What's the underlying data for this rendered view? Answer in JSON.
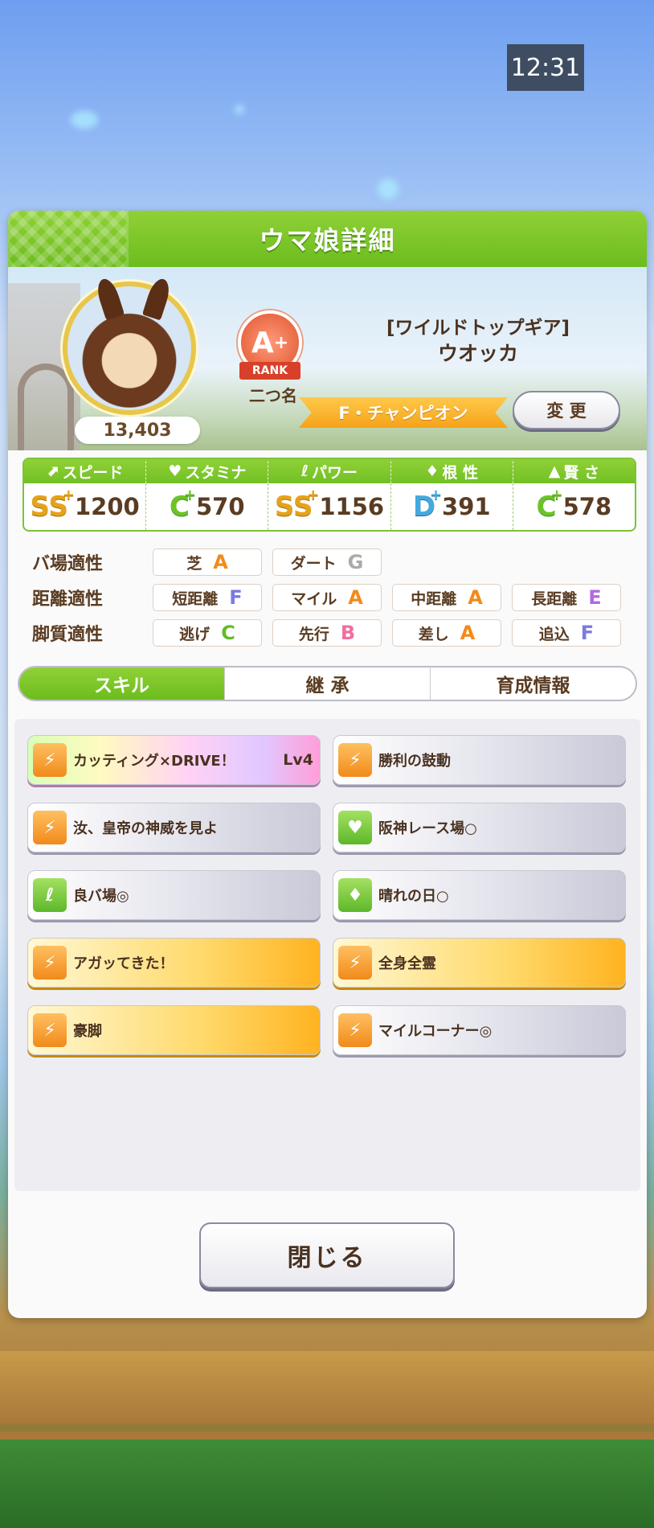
{
  "status_bar": {
    "clock": "12:31"
  },
  "panel": {
    "title": "ウマ娘詳細",
    "fans": "13,403",
    "rank": {
      "grade": "A",
      "plus": "+",
      "label": "RANK"
    },
    "nickname_label": "二つ名",
    "epithet": "[ワイルドトップギア]",
    "character_name": "ウオッカ",
    "title_ribbon": "F・チャンピオン",
    "change_button": "変 更"
  },
  "stats": [
    {
      "label": "スピード",
      "icon": "shoe-icon",
      "grade": "SS",
      "plus": "+",
      "value": "1200"
    },
    {
      "label": "スタミナ",
      "icon": "heart-icon",
      "grade": "C",
      "plus": "+",
      "value": "570"
    },
    {
      "label": "パワー",
      "icon": "muscle-icon",
      "grade": "SS",
      "plus": "+",
      "value": "1156"
    },
    {
      "label": "根 性",
      "icon": "flame-icon",
      "grade": "D",
      "plus": "+",
      "value": "391"
    },
    {
      "label": "賢 さ",
      "icon": "graduation-cap-icon",
      "grade": "C",
      "plus": "+",
      "value": "578"
    }
  ],
  "aptitudes": {
    "track": {
      "label": "バ場適性",
      "items": [
        {
          "name": "芝",
          "grade": "A"
        },
        {
          "name": "ダート",
          "grade": "G"
        }
      ]
    },
    "distance": {
      "label": "距離適性",
      "items": [
        {
          "name": "短距離",
          "grade": "F"
        },
        {
          "name": "マイル",
          "grade": "A"
        },
        {
          "name": "中距離",
          "grade": "A"
        },
        {
          "name": "長距離",
          "grade": "E"
        }
      ]
    },
    "style": {
      "label": "脚質適性",
      "items": [
        {
          "name": "逃げ",
          "grade": "C"
        },
        {
          "name": "先行",
          "grade": "B"
        },
        {
          "name": "差し",
          "grade": "A"
        },
        {
          "name": "追込",
          "grade": "F"
        }
      ]
    }
  },
  "tabs": [
    "スキル",
    "継 承",
    "育成情報"
  ],
  "skills": [
    {
      "name": "カッティング×DRIVE！",
      "level": "Lv4",
      "style": "rainbow",
      "icon": "running-icon"
    },
    {
      "name": "勝利の鼓動",
      "level": "",
      "style": "white",
      "icon": "running-icon"
    },
    {
      "name": "汝、皇帝の神威を見よ",
      "level": "",
      "style": "white",
      "icon": "running-icon"
    },
    {
      "name": "阪神レース場○",
      "level": "",
      "style": "white",
      "icon": "heart-icon"
    },
    {
      "name": "良バ場◎",
      "level": "",
      "style": "white",
      "icon": "muscle-icon"
    },
    {
      "name": "晴れの日○",
      "level": "",
      "style": "white",
      "icon": "flame-icon"
    },
    {
      "name": "アガッてきた！",
      "level": "",
      "style": "gold",
      "icon": "running-icon"
    },
    {
      "name": "全身全霊",
      "level": "",
      "style": "gold",
      "icon": "running-icon"
    },
    {
      "name": "豪脚",
      "level": "",
      "style": "gold",
      "icon": "running-icon"
    },
    {
      "name": "マイルコーナー◎",
      "level": "",
      "style": "white",
      "icon": "running-icon"
    }
  ],
  "close_button": "閉じる",
  "colors": {
    "accent_green": "#6cbc1e",
    "gold": "#f5a21a",
    "text_brown": "#4a3220"
  }
}
